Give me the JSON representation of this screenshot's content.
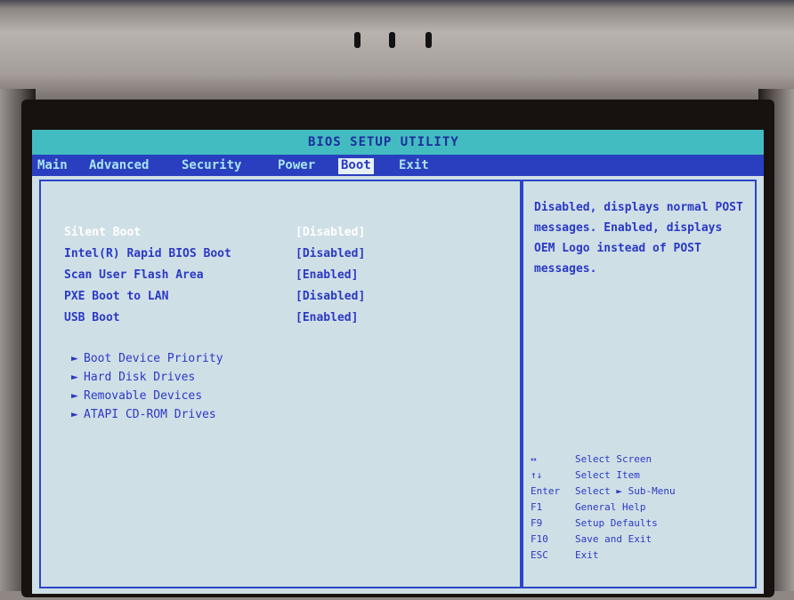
{
  "title": "BIOS SETUP UTILITY",
  "menu": [
    {
      "label": "Main"
    },
    {
      "label": "Advanced"
    },
    {
      "label": "Security"
    },
    {
      "label": "Power"
    },
    {
      "label": "Boot",
      "active": true
    },
    {
      "label": "Exit"
    }
  ],
  "settings": [
    {
      "label": "Silent Boot",
      "value": "[Disabled]",
      "selected": true
    },
    {
      "label": "Intel(R) Rapid BIOS Boot",
      "value": "[Disabled]"
    },
    {
      "label": "Scan User Flash Area",
      "value": "[Enabled]"
    },
    {
      "label": "PXE Boot to LAN",
      "value": "[Disabled]"
    },
    {
      "label": "USB Boot",
      "value": "[Enabled]"
    }
  ],
  "submenus": [
    {
      "arrow": "►",
      "label": "Boot Device Priority"
    },
    {
      "arrow": "►",
      "label": "Hard Disk Drives"
    },
    {
      "arrow": "►",
      "label": "Removable Devices"
    },
    {
      "arrow": "►",
      "label": "ATAPI CD-ROM Drives"
    }
  ],
  "help_text": "Disabled, displays normal POST messages. Enabled, displays OEM Logo instead of POST messages.",
  "keys": [
    {
      "key": "↔",
      "desc": "Select Screen"
    },
    {
      "key": "↑↓",
      "desc": "Select Item"
    },
    {
      "key": "Enter",
      "desc": "Select ► Sub-Menu"
    },
    {
      "key": "F1",
      "desc": "General Help"
    },
    {
      "key": "F9",
      "desc": "Setup Defaults"
    },
    {
      "key": "F10",
      "desc": "Save and Exit"
    },
    {
      "key": "ESC",
      "desc": "Exit"
    }
  ],
  "colors": {
    "screen_bg": "#cfdfe6",
    "title_bar": "#43bcc1",
    "menu_bar": "#2a3fbf",
    "text": "#2a39c4",
    "highlight": "#ffffff"
  }
}
